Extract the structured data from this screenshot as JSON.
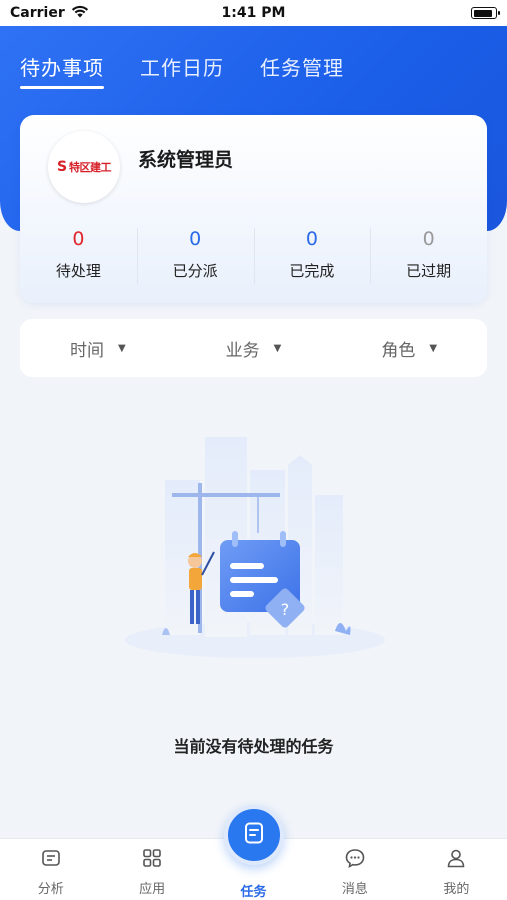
{
  "status_bar": {
    "carrier": "Carrier",
    "time": "1:41 PM"
  },
  "top_tabs": [
    {
      "label": "待办事项",
      "active": true
    },
    {
      "label": "工作日历",
      "active": false
    },
    {
      "label": "任务管理",
      "active": false
    }
  ],
  "profile": {
    "logo_text": "特区建工",
    "name": "系统管理员"
  },
  "stats": [
    {
      "value": "0",
      "label": "待处理",
      "color": "#e0262c"
    },
    {
      "value": "0",
      "label": "已分派",
      "color": "#2a6be8"
    },
    {
      "value": "0",
      "label": "已完成",
      "color": "#2a6be8"
    },
    {
      "value": "0",
      "label": "已过期",
      "color": "#999999"
    }
  ],
  "filters": [
    {
      "label": "时间"
    },
    {
      "label": "业务"
    },
    {
      "label": "角色"
    }
  ],
  "empty_state": {
    "message": "当前没有待处理的任务"
  },
  "tabbar": [
    {
      "label": "分析",
      "icon": "analysis-icon"
    },
    {
      "label": "应用",
      "icon": "apps-grid-icon"
    },
    {
      "label": "任务",
      "icon": "task-icon",
      "active": true
    },
    {
      "label": "消息",
      "icon": "message-icon"
    },
    {
      "label": "我的",
      "icon": "user-icon"
    }
  ],
  "colors": {
    "primary": "#2a6be8",
    "header": "#2f72f5",
    "alert": "#e0262c"
  }
}
